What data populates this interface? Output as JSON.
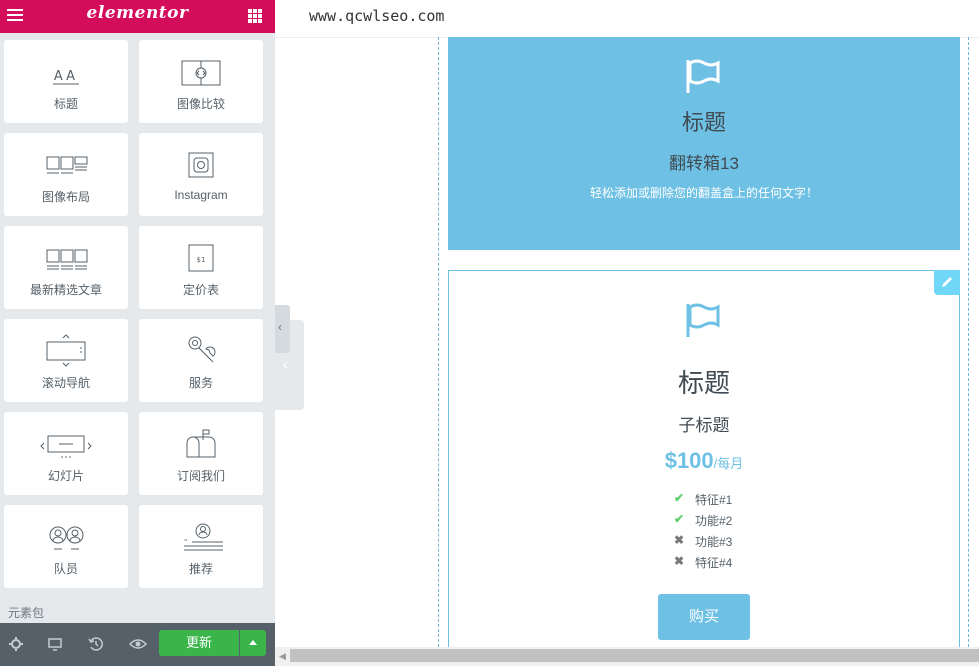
{
  "panel": {
    "logo": "elementor",
    "widgets": [
      {
        "label": "标题",
        "icon": "heading-icon"
      },
      {
        "label": "图像比较",
        "icon": "image-compare-icon"
      },
      {
        "label": "图像布局",
        "icon": "image-layout-icon"
      },
      {
        "label": "Instagram",
        "icon": "instagram-icon"
      },
      {
        "label": "最新精选文章",
        "icon": "posts-icon"
      },
      {
        "label": "定价表",
        "icon": "price-table-icon"
      },
      {
        "label": "滚动导航",
        "icon": "scroll-nav-icon"
      },
      {
        "label": "服务",
        "icon": "services-icon"
      },
      {
        "label": "幻灯片",
        "icon": "slides-icon"
      },
      {
        "label": "订阅我们",
        "icon": "subscribe-icon"
      },
      {
        "label": "队员",
        "icon": "team-icon"
      },
      {
        "label": "推荐",
        "icon": "testimonial-icon"
      }
    ],
    "category": "元素包",
    "footer": {
      "update_label": "更新"
    }
  },
  "canvas": {
    "url": "www.qcwlseo.com",
    "flipbox": {
      "title": "标题",
      "subtitle": "翻转箱13",
      "description": "轻松添加或删除您的翻盖盒上的任何文字！"
    },
    "price_table": {
      "title": "标题",
      "subtitle": "子标题",
      "price": "$100",
      "period": "/每月",
      "features": [
        {
          "text": "特征#1",
          "included": true
        },
        {
          "text": "功能#2",
          "included": true
        },
        {
          "text": "功能#3",
          "included": false
        },
        {
          "text": "特征#4",
          "included": false
        }
      ],
      "button": "购买"
    }
  },
  "colors": {
    "brand": "#d30c5c",
    "accent": "#6ec1e4",
    "update": "#39b54a"
  }
}
